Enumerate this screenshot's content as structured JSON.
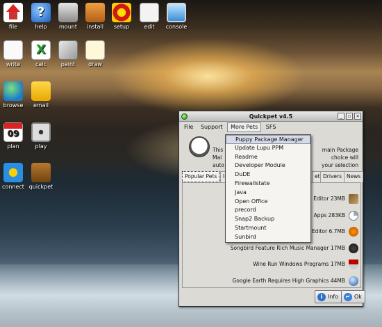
{
  "desktop": {
    "icons": [
      {
        "label": "file",
        "icon": "home-icon"
      },
      {
        "label": "help",
        "icon": "help-icon"
      },
      {
        "label": "mount",
        "icon": "drive-icon"
      },
      {
        "label": "install",
        "icon": "briefcase-icon"
      },
      {
        "label": "setup",
        "icon": "setup-icon"
      },
      {
        "label": "edit",
        "icon": "edit-icon"
      },
      {
        "label": "console",
        "icon": "monitor-icon"
      },
      {
        "label": "write",
        "icon": "document-icon"
      },
      {
        "label": "calc",
        "icon": "spreadsheet-icon"
      },
      {
        "label": "paint",
        "icon": "paint-icon"
      },
      {
        "label": "draw",
        "icon": "draw-icon"
      },
      {
        "label": "browse",
        "icon": "globe-icon"
      },
      {
        "label": "email",
        "icon": "envelope-icon"
      },
      {
        "label": "plan",
        "icon": "calendar-icon"
      },
      {
        "label": "play",
        "icon": "film-reel-icon"
      },
      {
        "label": "connect",
        "icon": "network-icon"
      },
      {
        "label": "quickpet",
        "icon": "toolbox-icon"
      }
    ],
    "calendar_day": "09"
  },
  "window": {
    "title": "Quickpet v4.5",
    "menubar": [
      "File",
      "Support",
      "More Pets",
      "SFS"
    ],
    "intro_left": [
      "This",
      "Mai",
      "auto"
    ],
    "intro_right": [
      "main Package",
      "choice will",
      "your selection"
    ],
    "tabs": [
      "Popular Pets",
      "I",
      "et",
      "Drivers",
      "News"
    ],
    "rows": [
      {
        "text": "Editor 23MB",
        "icon": "pen-icon"
      },
      {
        "text": "Apps 283KB",
        "icon": "pie-icon"
      },
      {
        "text": "Editor 6.7MB",
        "icon": "headphones-icon"
      },
      {
        "text": "Songbird Feature Rich Music Manager 17MB",
        "icon": "songbird-icon"
      },
      {
        "text": "Wine  Run Windows Programs 17MB",
        "icon": "wine-icon"
      },
      {
        "text": "Google Earth  Requires High Graphics 44MB",
        "icon": "globe-icon"
      }
    ],
    "buttons": {
      "info": "Info",
      "ok": "Ok"
    }
  },
  "dropdown": {
    "items": [
      "Puppy Package Manager",
      "Update Lupu PPM",
      "Readme",
      "Developer Module",
      "DuDE",
      "Firewallstate",
      "Java",
      "Open Office",
      "precord",
      "Snap2 Backup",
      "Startmount",
      "Sunbird"
    ],
    "highlighted": "Puppy Package Manager"
  }
}
